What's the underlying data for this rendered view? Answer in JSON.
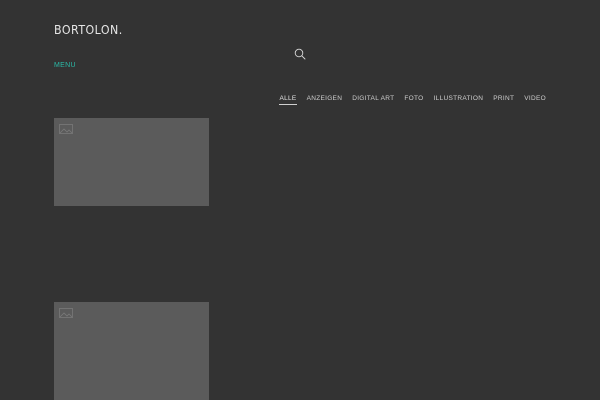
{
  "header": {
    "logo": "BORTOLON.",
    "menu_label": "MENU"
  },
  "icons": {
    "search": "search-icon"
  },
  "colors": {
    "background": "#333333",
    "accent": "#2bb9a7",
    "thumbnail": "#5b5b5b"
  },
  "filters": [
    {
      "label": "ALLE",
      "active": true
    },
    {
      "label": "ANZEIGEN",
      "active": false
    },
    {
      "label": "DIGITAL ART",
      "active": false
    },
    {
      "label": "FOTO",
      "active": false
    },
    {
      "label": "ILLUSTRATION",
      "active": false
    },
    {
      "label": "PRINT",
      "active": false
    },
    {
      "label": "VIDEO",
      "active": false
    }
  ]
}
